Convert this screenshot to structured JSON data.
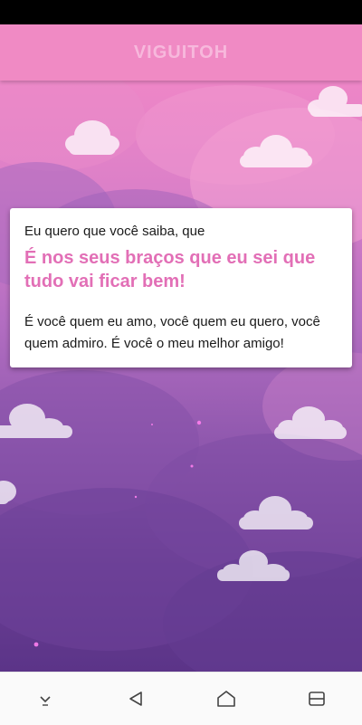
{
  "app_bar": {
    "title": "VIGUITOH"
  },
  "card": {
    "intro": "Eu quero que você saiba, que",
    "headline": "É nos seus braços que eu sei que tudo vai ficar bem!",
    "body": "É você quem eu amo, você quem eu quero, você quem admiro. É você o meu melhor amigo!"
  },
  "colors": {
    "app_bar": "#f08ac4",
    "app_title": "#f7b8dc",
    "headline": "#e26fb6",
    "background_top": "#ee86c7",
    "background_bottom": "#5b3488"
  },
  "nav_bar": {
    "icons": [
      "hide-keyboard-icon",
      "back-icon",
      "home-icon",
      "recent-apps-icon"
    ]
  }
}
